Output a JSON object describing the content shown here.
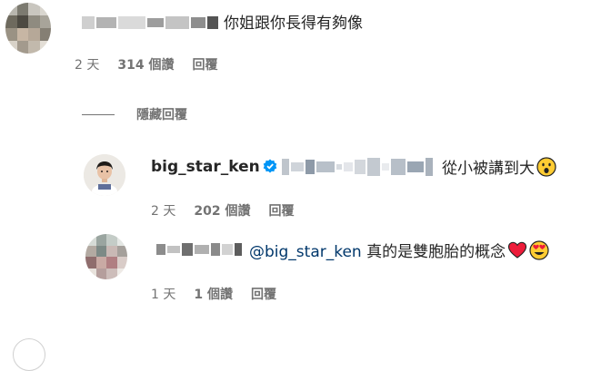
{
  "comment1": {
    "text": "你姐跟你長得有夠像",
    "time": "2 天",
    "likes": "314 個讚",
    "reply": "回覆"
  },
  "hide_replies": "隱藏回覆",
  "reply1": {
    "username": "big_star_ken",
    "text": "從小被講到大",
    "time": "2 天",
    "likes": "202 個讚",
    "reply": "回覆"
  },
  "reply2": {
    "mention": "@big_star_ken",
    "text": " 真的是雙胞胎的概念",
    "time": "1 天",
    "likes": "1 個讚",
    "reply": "回覆"
  },
  "colors": {
    "muted": "#737373",
    "mention": "#00376b",
    "verified": "#0095f6",
    "heart": "#ed1c3a"
  }
}
